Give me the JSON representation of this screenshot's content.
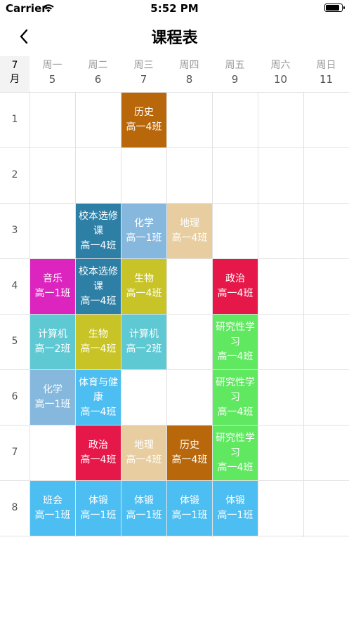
{
  "status_bar": {
    "carrier": "Carrier",
    "time": "5:52 PM"
  },
  "nav": {
    "title": "课程表"
  },
  "header": {
    "month_num": "7",
    "month_unit": "月",
    "days": [
      {
        "name": "周一",
        "date": "5"
      },
      {
        "name": "周二",
        "date": "6"
      },
      {
        "name": "周三",
        "date": "7"
      },
      {
        "name": "周四",
        "date": "8"
      },
      {
        "name": "周五",
        "date": "9"
      },
      {
        "name": "周六",
        "date": "10"
      },
      {
        "name": "周日",
        "date": "11"
      }
    ]
  },
  "periods": [
    "1",
    "2",
    "3",
    "4",
    "5",
    "6",
    "7",
    "8"
  ],
  "courses": [
    {
      "day": 3,
      "period": 1,
      "lines": [
        "历史",
        "高一4班"
      ],
      "color": "#b8670b"
    },
    {
      "day": 2,
      "period": 3,
      "lines": [
        "校本选修",
        "课",
        "高一4班"
      ],
      "color": "#2e7fa6"
    },
    {
      "day": 3,
      "period": 3,
      "lines": [
        "化学",
        "高一1班"
      ],
      "color": "#86b8de"
    },
    {
      "day": 4,
      "period": 3,
      "lines": [
        "地理",
        "高一4班"
      ],
      "color": "#e7cd9f"
    },
    {
      "day": 1,
      "period": 4,
      "lines": [
        "音乐",
        "高一1班"
      ],
      "color": "#dc24be"
    },
    {
      "day": 2,
      "period": 4,
      "lines": [
        "校本选修",
        "课",
        "高一4班"
      ],
      "color": "#2e7fa6"
    },
    {
      "day": 3,
      "period": 4,
      "lines": [
        "生物",
        "高一4班"
      ],
      "color": "#c8c326"
    },
    {
      "day": 5,
      "period": 4,
      "lines": [
        "政治",
        "高一4班"
      ],
      "color": "#e6184a"
    },
    {
      "day": 1,
      "period": 5,
      "lines": [
        "计算机",
        "高一2班"
      ],
      "color": "#5ec8d3"
    },
    {
      "day": 2,
      "period": 5,
      "lines": [
        "生物",
        "高一4班"
      ],
      "color": "#c8c326"
    },
    {
      "day": 3,
      "period": 5,
      "lines": [
        "计算机",
        "高一2班"
      ],
      "color": "#5ec8d3"
    },
    {
      "day": 5,
      "period": 5,
      "lines": [
        "研究性学",
        "习",
        "高一4班"
      ],
      "color": "#5fe860"
    },
    {
      "day": 1,
      "period": 6,
      "lines": [
        "化学",
        "高一1班"
      ],
      "color": "#86b8de"
    },
    {
      "day": 2,
      "period": 6,
      "lines": [
        "体育与健",
        "康",
        "高一4班"
      ],
      "color": "#4cbef1"
    },
    {
      "day": 5,
      "period": 6,
      "lines": [
        "研究性学",
        "习",
        "高一4班"
      ],
      "color": "#5fe860"
    },
    {
      "day": 2,
      "period": 7,
      "lines": [
        "政治",
        "高一4班"
      ],
      "color": "#e6184a"
    },
    {
      "day": 3,
      "period": 7,
      "lines": [
        "地理",
        "高一4班"
      ],
      "color": "#e7cd9f"
    },
    {
      "day": 4,
      "period": 7,
      "lines": [
        "历史",
        "高一4班"
      ],
      "color": "#b8670b"
    },
    {
      "day": 5,
      "period": 7,
      "lines": [
        "研究性学",
        "习",
        "高一4班"
      ],
      "color": "#5fe860"
    },
    {
      "day": 1,
      "period": 8,
      "lines": [
        "班会",
        "高一1班"
      ],
      "color": "#4cbef1"
    },
    {
      "day": 2,
      "period": 8,
      "lines": [
        "体锻",
        "高一1班"
      ],
      "color": "#4cbef1"
    },
    {
      "day": 3,
      "period": 8,
      "lines": [
        "体锻",
        "高一1班"
      ],
      "color": "#4cbef1"
    },
    {
      "day": 4,
      "period": 8,
      "lines": [
        "体锻",
        "高一1班"
      ],
      "color": "#4cbef1"
    },
    {
      "day": 5,
      "period": 8,
      "lines": [
        "体锻",
        "高一1班"
      ],
      "color": "#4cbef1"
    }
  ]
}
